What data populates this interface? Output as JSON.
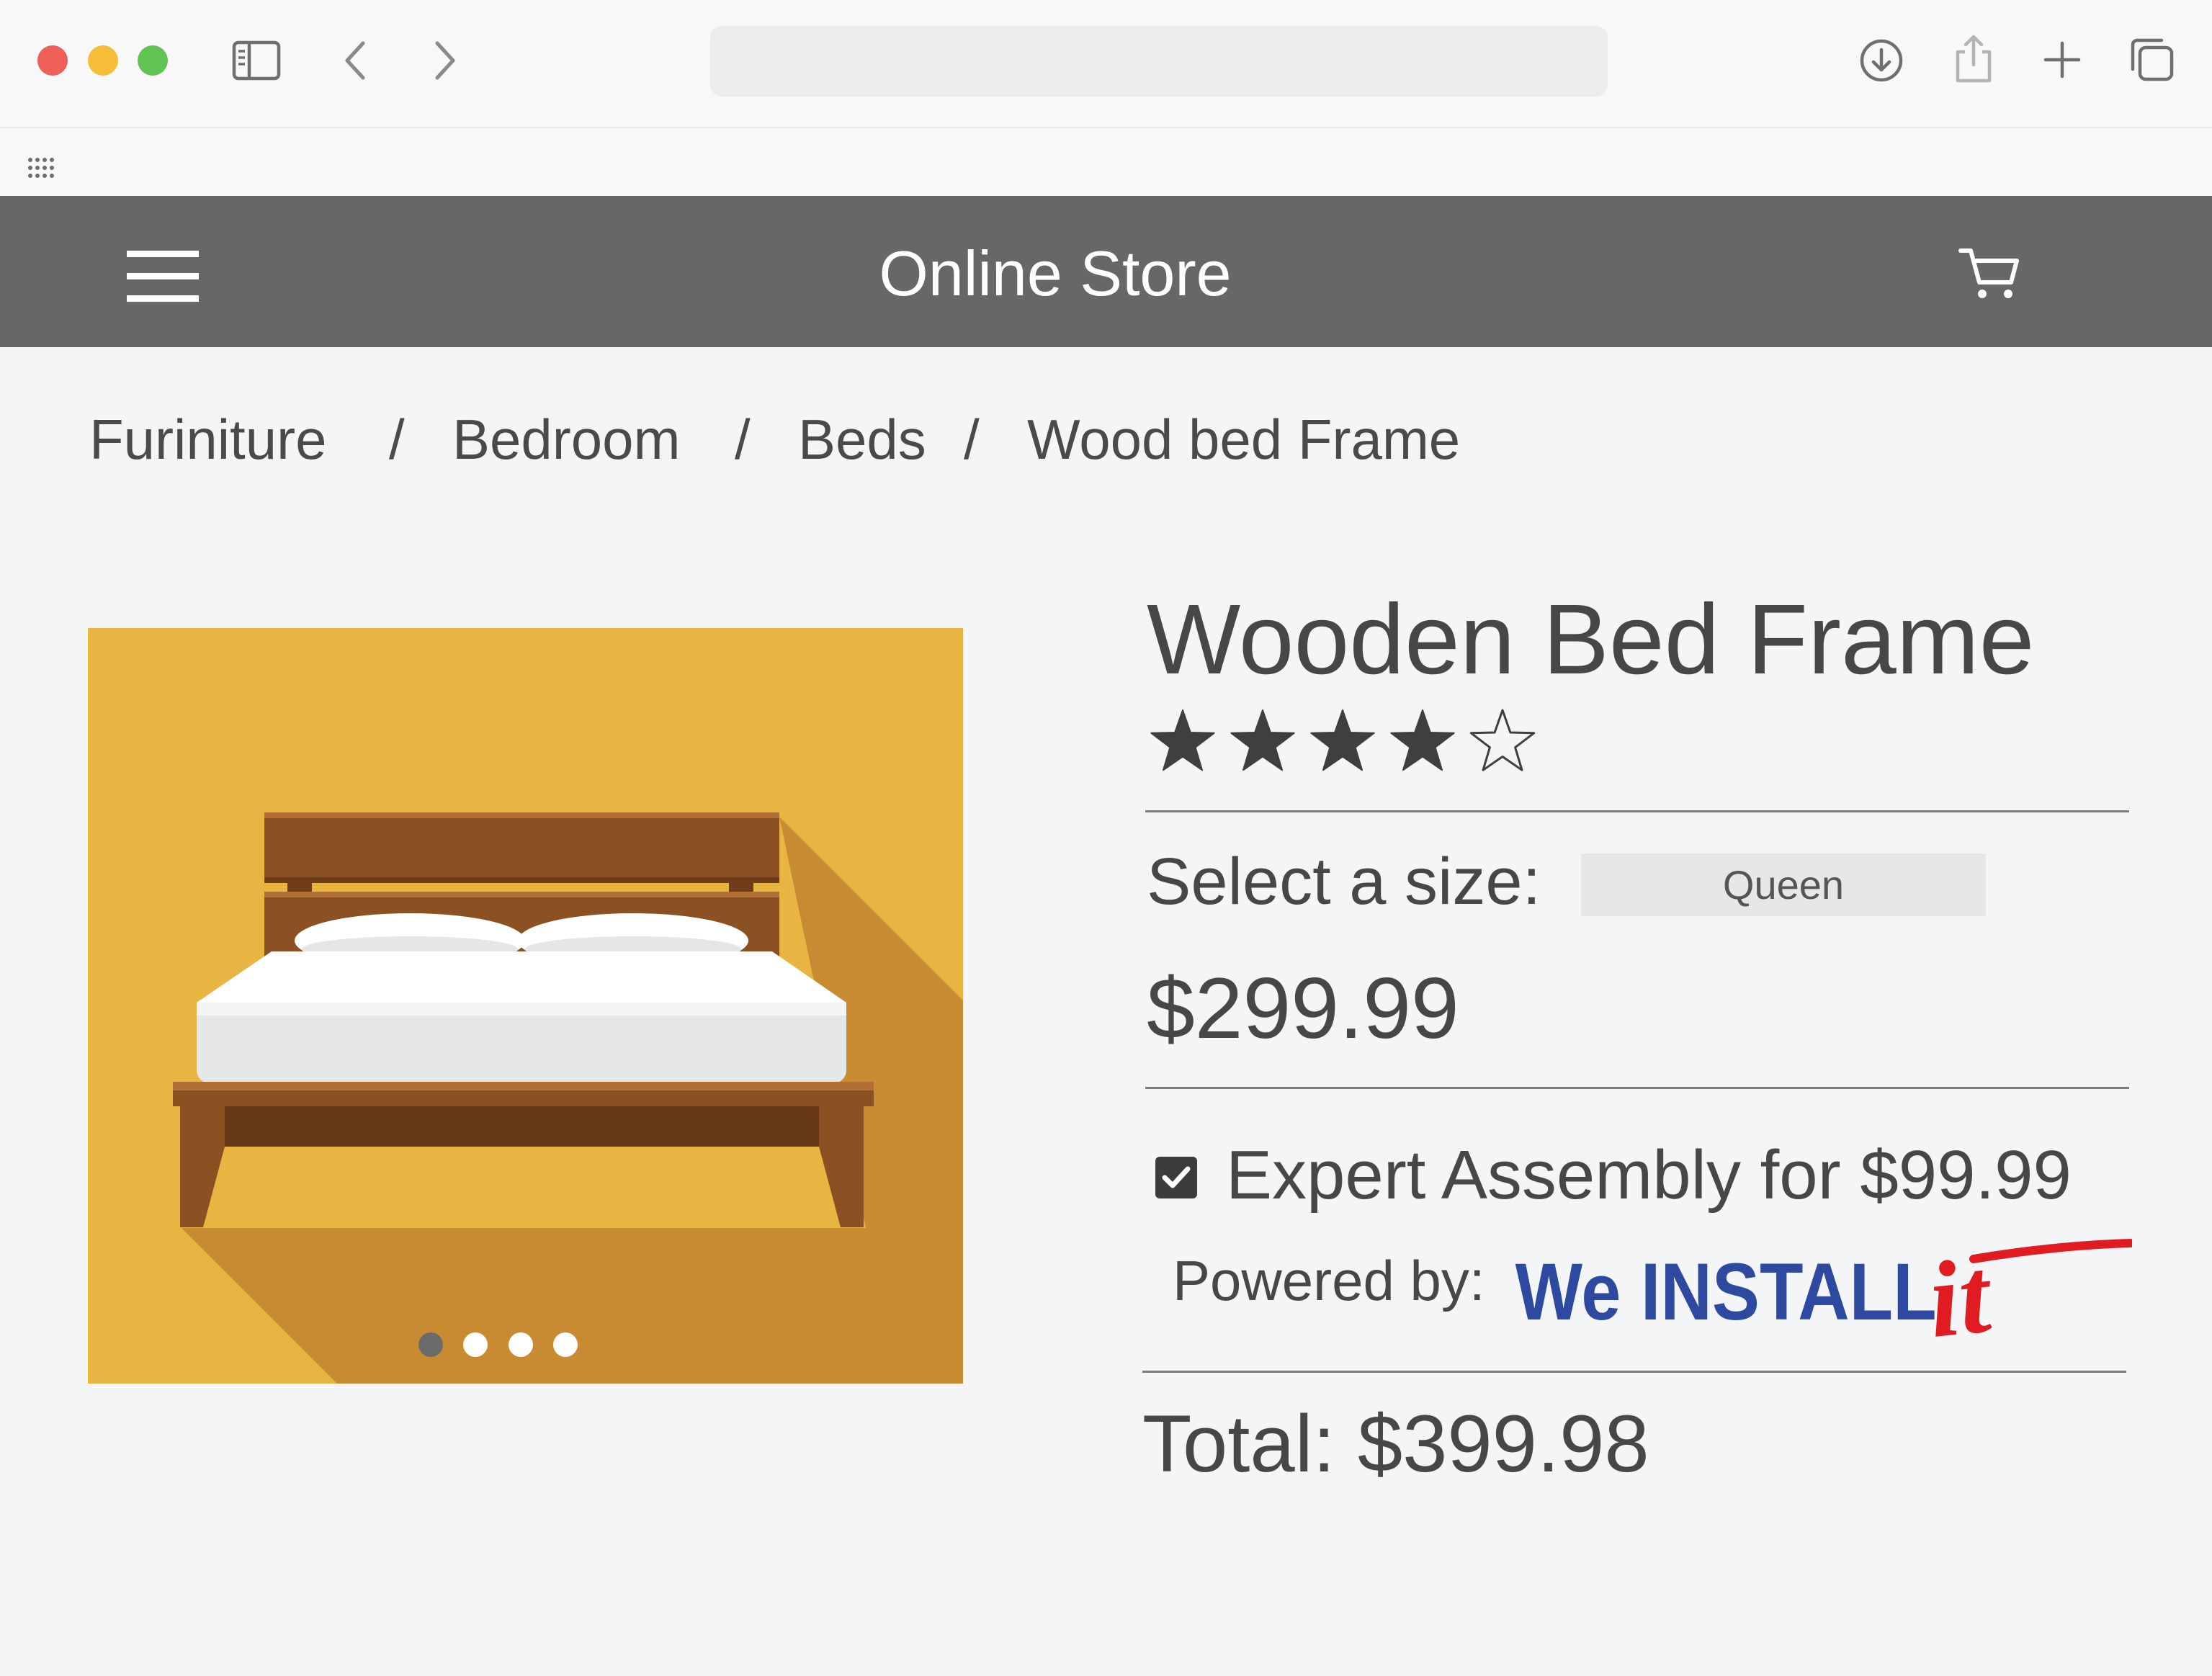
{
  "browser": {
    "icons": [
      "sidebar-icon",
      "back-icon",
      "forward-icon",
      "download-icon",
      "share-icon",
      "new-tab-icon",
      "tabs-overview-icon",
      "apps-grid-icon"
    ]
  },
  "header": {
    "title": "Online Store",
    "menu_icon": "hamburger-icon",
    "cart_icon": "cart-icon"
  },
  "breadcrumb": {
    "items": [
      "Furiniture",
      "Bedroom",
      "Beds",
      "Wood bed Frame"
    ],
    "separator": "/"
  },
  "product": {
    "title": "Wooden Bed Frame",
    "rating": 4,
    "rating_max": 5,
    "size_label": "Select a size:",
    "size_value": "Queen",
    "price": "$299.99",
    "assembly_checked": true,
    "assembly_label": "Expert Assembly for $99.99",
    "powered_label": "Powered by:",
    "logo_text": {
      "main": "We INSTALL",
      "script": "it"
    },
    "total": "Total: $399.98",
    "image": {
      "subject": "wooden bed frame illustration",
      "carousel_slides": 4,
      "carousel_active": 1,
      "background_color": "#e9b542",
      "shadow_color": "#c98b31",
      "wood_color": "#8b5122"
    }
  },
  "colors": {
    "header_bg": "#676767",
    "page_bg": "#f4f5f7",
    "text": "#474749",
    "logo_blue": "#2d4aa0",
    "logo_red": "#e01b22"
  }
}
